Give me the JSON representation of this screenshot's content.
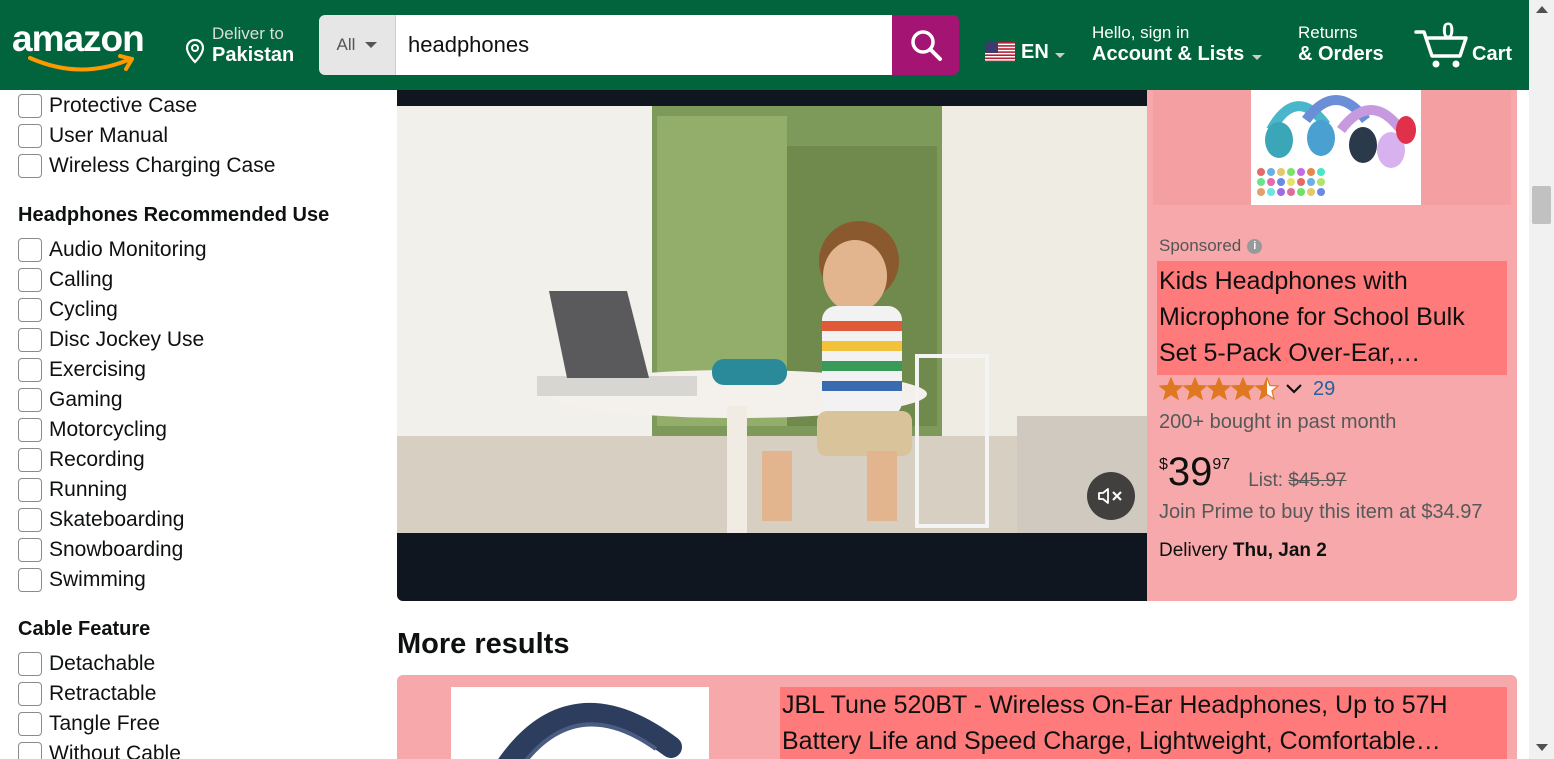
{
  "header": {
    "logo_text": "amazon",
    "deliver_label": "Deliver to",
    "deliver_location": "Pakistan",
    "search_category": "All",
    "search_query": "headphones",
    "language_code": "EN",
    "account_greeting": "Hello, sign in",
    "account_label": "Account & Lists",
    "returns_label": "Returns",
    "orders_label": "& Orders",
    "cart_count": "0",
    "cart_label": "Cart"
  },
  "sidebar": {
    "top_items": [
      "Protective Case",
      "User Manual",
      "Wireless Charging Case"
    ],
    "recommended_use_title": "Headphones Recommended Use",
    "recommended_use_items": [
      "Audio Monitoring",
      "Calling",
      "Cycling",
      "Disc Jockey Use",
      "Exercising",
      "Gaming",
      "Motorcycling",
      "Recording",
      "Running",
      "Skateboarding",
      "Snowboarding",
      "Swimming"
    ],
    "cable_feature_title": "Cable Feature",
    "cable_feature_items": [
      "Detachable",
      "Retractable",
      "Tangle Free",
      "Without Cable"
    ]
  },
  "sponsored_ad": {
    "sponsored_label": "Sponsored",
    "title": "Kids Headphones with Microphone for School Bulk Set 5-Pack Over-Ear,…",
    "rating_value": 4.5,
    "rating_count": "29",
    "bought_text": "200+ bought in past month",
    "price_symbol": "$",
    "price_whole": "39",
    "price_fraction": "97",
    "list_label": "List:",
    "list_price": "$45.97",
    "prime_text": "Join Prime to buy this item at $34.97",
    "delivery_label": "Delivery",
    "delivery_date": "Thu, Jan 2"
  },
  "more_results": {
    "title": "More results",
    "first_result_title_line1": "JBL Tune 520BT - Wireless On-Ear Headphones, Up to 57H",
    "first_result_title_line2": "Battery Life and Speed Charge, Lightweight, Comfortable…"
  },
  "colors": {
    "header_bg": "#02643c",
    "search_button": "#a41473",
    "highlight_panel": "#f7a8aa",
    "highlight_title": "#fe7a7b",
    "star": "#de7921",
    "link": "#2162a1"
  }
}
